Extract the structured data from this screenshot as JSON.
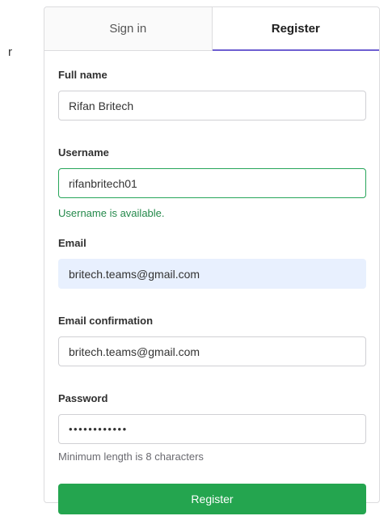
{
  "stray_text": "r",
  "tabs": [
    {
      "label": "Sign in",
      "active": false
    },
    {
      "label": "Register",
      "active": true
    }
  ],
  "form": {
    "full_name": {
      "label": "Full name",
      "value": "Rifan Britech"
    },
    "username": {
      "label": "Username",
      "value": "rifanbritech01",
      "status": "Username is available."
    },
    "email": {
      "label": "Email",
      "value": "britech.teams@gmail.com"
    },
    "email_confirmation": {
      "label": "Email confirmation",
      "value": "britech.teams@gmail.com"
    },
    "password": {
      "label": "Password",
      "value": "••••••••••••",
      "hint": "Minimum length is 8 characters"
    }
  },
  "submit_label": "Register",
  "colors": {
    "accent_tab": "#6e5fd1",
    "success": "#24894b",
    "button": "#24a54f",
    "autofill_bg": "#e8f0fe"
  }
}
